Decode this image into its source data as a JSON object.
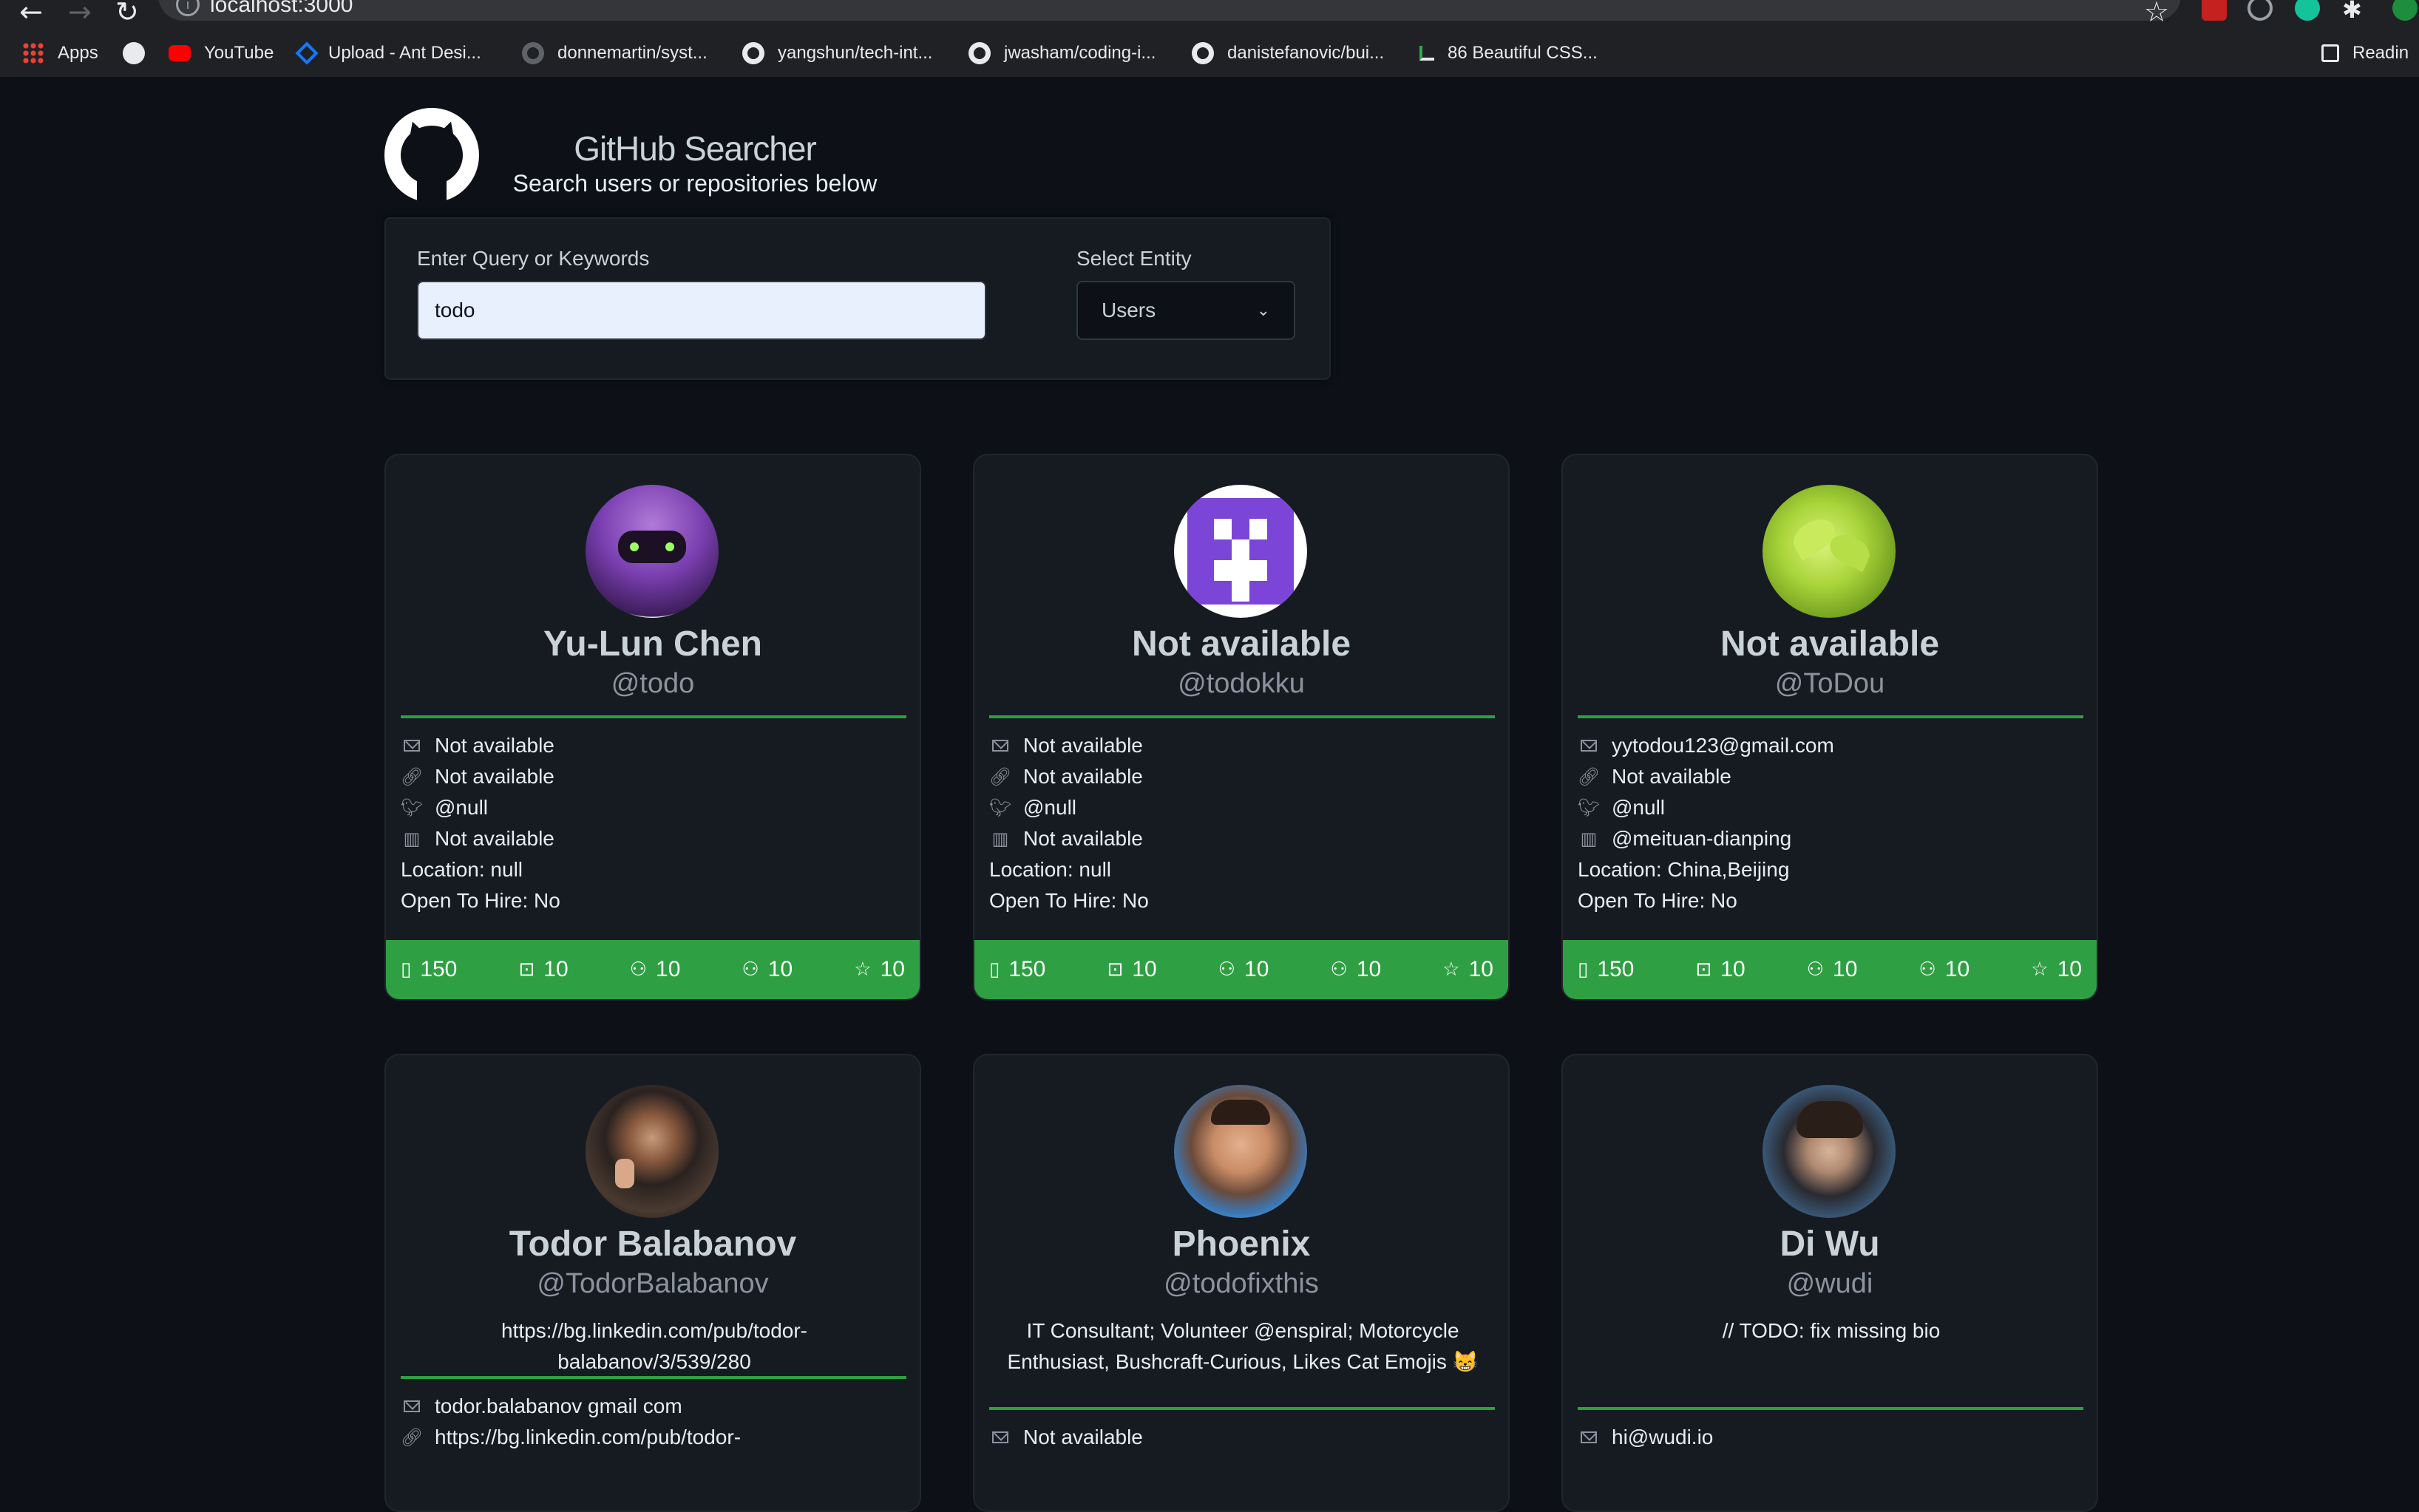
{
  "browser": {
    "url": "localhost:3000",
    "bookmarks": [
      {
        "label": "Apps",
        "icon": "apps-grid-icon"
      },
      {
        "label": "",
        "icon": "globe-icon"
      },
      {
        "label": "YouTube",
        "icon": "youtube-icon"
      },
      {
        "label": "Upload - Ant Desi...",
        "icon": "ant-design-icon"
      },
      {
        "label": "donnemartin/syst...",
        "icon": "github-icon"
      },
      {
        "label": "yangshun/tech-int...",
        "icon": "github-icon"
      },
      {
        "label": "jwasham/coding-i...",
        "icon": "github-icon"
      },
      {
        "label": "danistefanovic/bui...",
        "icon": "github-icon"
      },
      {
        "label": "86 Beautiful CSS...",
        "icon": "css-site-icon"
      }
    ],
    "reading_list": "Readin"
  },
  "header": {
    "title": "GitHub Searcher",
    "subtitle": "Search users or repositories below"
  },
  "search": {
    "query_label": "Enter Query or Keywords",
    "query_value": "todo",
    "entity_label": "Select Entity",
    "entity_value": "Users"
  },
  "colors": {
    "accent": "#2ea043",
    "background": "#0d1117",
    "card": "#161b22"
  },
  "cards": [
    {
      "name": "Yu-Lun Chen",
      "login": "@todo",
      "bio": "",
      "email": "Not available",
      "blog": "Not available",
      "twitter": "@null",
      "company": "Not available",
      "location": "Location: null",
      "hire": "Open To Hire: No",
      "stats": {
        "repos": "150",
        "gists": "10",
        "followers": "10",
        "following": "10",
        "stars": "10"
      }
    },
    {
      "name": "Not available",
      "login": "@todokku",
      "bio": "",
      "email": "Not available",
      "blog": "Not available",
      "twitter": "@null",
      "company": "Not available",
      "location": "Location: null",
      "hire": "Open To Hire: No",
      "stats": {
        "repos": "150",
        "gists": "10",
        "followers": "10",
        "following": "10",
        "stars": "10"
      }
    },
    {
      "name": "Not available",
      "login": "@ToDou",
      "bio": "",
      "email": "yytodou123@gmail.com",
      "blog": "Not available",
      "twitter": "@null",
      "company": "@meituan-dianping",
      "location": "Location: China,Beijing",
      "hire": "Open To Hire: No",
      "stats": {
        "repos": "150",
        "gists": "10",
        "followers": "10",
        "following": "10",
        "stars": "10"
      }
    },
    {
      "name": "Todor Balabanov",
      "login": "@TodorBalabanov",
      "bio_line1": "https://bg.linkedin.com/pub/todor-",
      "bio_line2": "balabanov/3/539/280",
      "email": "todor.balabanov gmail com",
      "blog": "https://bg.linkedin.com/pub/todor-"
    },
    {
      "name": "Phoenix",
      "login": "@todofixthis",
      "bio_line1": "IT Consultant; Volunteer @enspiral; Motorcycle",
      "bio_line2": "Enthusiast, Bushcraft-Curious, Likes Cat Emojis 😸",
      "email": "Not available"
    },
    {
      "name": "Di Wu",
      "login": "@wudi",
      "bio_line1": "// TODO: fix missing bio",
      "email": "hi@wudi.io"
    }
  ]
}
